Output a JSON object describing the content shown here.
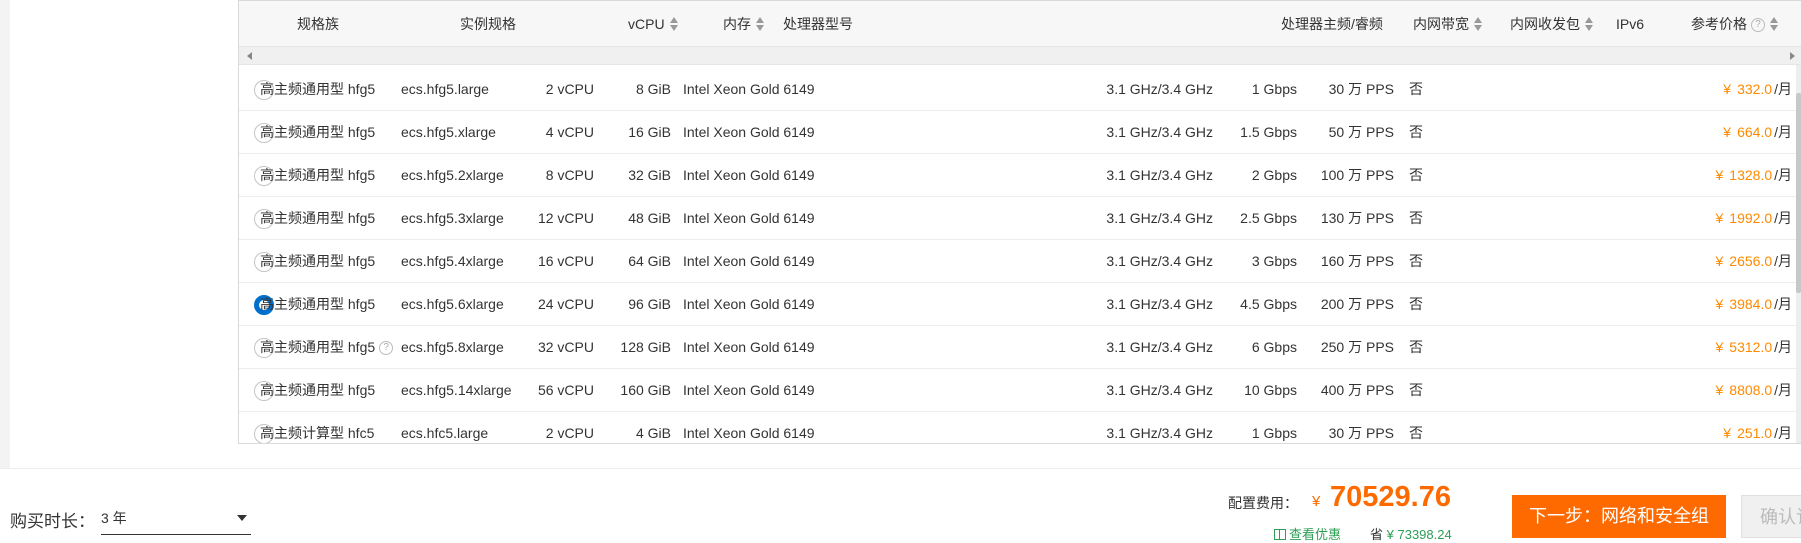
{
  "table": {
    "headers": {
      "family": "规格族",
      "instance": "实例规格",
      "vcpu": "vCPU",
      "memory": "内存",
      "processor": "处理器型号",
      "freq": "处理器主频/睿频",
      "bandwidth": "内网带宽",
      "pps": "内网收发包",
      "ipv6": "IPv6",
      "price": "参考价格"
    },
    "help_glyph": "?",
    "price_unit": "/月",
    "currency": "¥",
    "rows": [
      {
        "family": "高主频通用型 hfg5",
        "instance": "ecs.hfg5.large",
        "vcpu": "2 vCPU",
        "memory": "8 GiB",
        "processor": "Intel Xeon Gold 6149",
        "freq": "3.1 GHz/3.4 GHz",
        "bandwidth": "1 Gbps",
        "pps": "30 万 PPS",
        "ipv6": "否",
        "price": "332.0",
        "selected": false,
        "help": false
      },
      {
        "family": "高主频通用型 hfg5",
        "instance": "ecs.hfg5.xlarge",
        "vcpu": "4 vCPU",
        "memory": "16 GiB",
        "processor": "Intel Xeon Gold 6149",
        "freq": "3.1 GHz/3.4 GHz",
        "bandwidth": "1.5 Gbps",
        "pps": "50 万 PPS",
        "ipv6": "否",
        "price": "664.0",
        "selected": false,
        "help": false
      },
      {
        "family": "高主频通用型 hfg5",
        "instance": "ecs.hfg5.2xlarge",
        "vcpu": "8 vCPU",
        "memory": "32 GiB",
        "processor": "Intel Xeon Gold 6149",
        "freq": "3.1 GHz/3.4 GHz",
        "bandwidth": "2 Gbps",
        "pps": "100 万 PPS",
        "ipv6": "否",
        "price": "1328.0",
        "selected": false,
        "help": false
      },
      {
        "family": "高主频通用型 hfg5",
        "instance": "ecs.hfg5.3xlarge",
        "vcpu": "12 vCPU",
        "memory": "48 GiB",
        "processor": "Intel Xeon Gold 6149",
        "freq": "3.1 GHz/3.4 GHz",
        "bandwidth": "2.5 Gbps",
        "pps": "130 万 PPS",
        "ipv6": "否",
        "price": "1992.0",
        "selected": false,
        "help": false
      },
      {
        "family": "高主频通用型 hfg5",
        "instance": "ecs.hfg5.4xlarge",
        "vcpu": "16 vCPU",
        "memory": "64 GiB",
        "processor": "Intel Xeon Gold 6149",
        "freq": "3.1 GHz/3.4 GHz",
        "bandwidth": "3 Gbps",
        "pps": "160 万 PPS",
        "ipv6": "否",
        "price": "2656.0",
        "selected": false,
        "help": false
      },
      {
        "family": "高主频通用型 hfg5",
        "instance": "ecs.hfg5.6xlarge",
        "vcpu": "24 vCPU",
        "memory": "96 GiB",
        "processor": "Intel Xeon Gold 6149",
        "freq": "3.1 GHz/3.4 GHz",
        "bandwidth": "4.5 Gbps",
        "pps": "200 万 PPS",
        "ipv6": "否",
        "price": "3984.0",
        "selected": true,
        "help": false
      },
      {
        "family": "高主频通用型 hfg5",
        "instance": "ecs.hfg5.8xlarge",
        "vcpu": "32 vCPU",
        "memory": "128 GiB",
        "processor": "Intel Xeon Gold 6149",
        "freq": "3.1 GHz/3.4 GHz",
        "bandwidth": "6 Gbps",
        "pps": "250 万 PPS",
        "ipv6": "否",
        "price": "5312.0",
        "selected": false,
        "help": true
      },
      {
        "family": "高主频通用型 hfg5",
        "instance": "ecs.hfg5.14xlarge",
        "vcpu": "56 vCPU",
        "memory": "160 GiB",
        "processor": "Intel Xeon Gold 6149",
        "freq": "3.1 GHz/3.4 GHz",
        "bandwidth": "10 Gbps",
        "pps": "400 万 PPS",
        "ipv6": "否",
        "price": "8808.0",
        "selected": false,
        "help": false
      },
      {
        "family": "高主频计算型 hfc5",
        "instance": "ecs.hfc5.large",
        "vcpu": "2 vCPU",
        "memory": "4 GiB",
        "processor": "Intel Xeon Gold 6149",
        "freq": "3.1 GHz/3.4 GHz",
        "bandwidth": "1 Gbps",
        "pps": "30 万 PPS",
        "ipv6": "否",
        "price": "251.0",
        "selected": false,
        "help": false
      }
    ]
  },
  "footer": {
    "duration_label": "购买时长：",
    "duration_value": "3 年",
    "cost_label": "配置费用：",
    "cost_currency": "¥",
    "cost_value": "70529.76",
    "discount_link": "查看优惠",
    "save_label": "省",
    "save_amount": "¥ 73398.24",
    "next_button": "下一步：网络和安全组",
    "confirm_button": "确认订"
  },
  "colors": {
    "accent": "#ff6a00",
    "price": "#ff8a00",
    "radio_selected": "#0070cc",
    "discount": "#2e9e56"
  }
}
